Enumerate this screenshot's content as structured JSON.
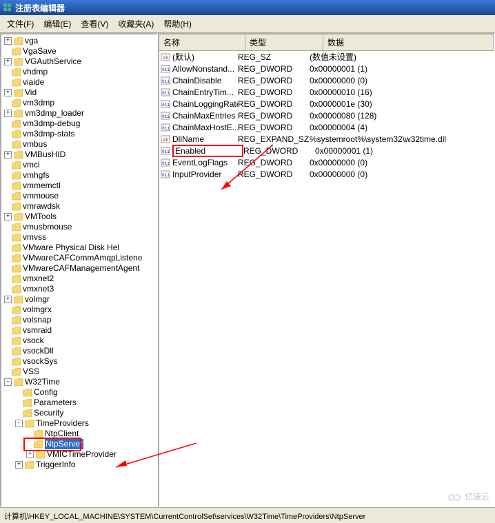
{
  "title": "注册表编辑器",
  "menu": {
    "file": "文件(F)",
    "edit": "编辑(E)",
    "view": "查看(V)",
    "fav": "收藏夹(A)",
    "help": "帮助(H)"
  },
  "columns": {
    "name": "名称",
    "type": "类型",
    "data": "数据"
  },
  "values": [
    {
      "icon": "sz",
      "name": "(默认)",
      "type": "REG_SZ",
      "data": "(数值未设置)"
    },
    {
      "icon": "bin",
      "name": "AllowNonstand...",
      "type": "REG_DWORD",
      "data": "0x00000001 (1)"
    },
    {
      "icon": "bin",
      "name": "ChainDisable",
      "type": "REG_DWORD",
      "data": "0x00000000 (0)"
    },
    {
      "icon": "bin",
      "name": "ChainEntryTim...",
      "type": "REG_DWORD",
      "data": "0x00000010 (16)"
    },
    {
      "icon": "bin",
      "name": "ChainLoggingRate",
      "type": "REG_DWORD",
      "data": "0x0000001e (30)"
    },
    {
      "icon": "bin",
      "name": "ChainMaxEntries",
      "type": "REG_DWORD",
      "data": "0x00000080 (128)"
    },
    {
      "icon": "bin",
      "name": "ChainMaxHostE...",
      "type": "REG_DWORD",
      "data": "0x00000004 (4)"
    },
    {
      "icon": "sz",
      "name": "DllName",
      "type": "REG_EXPAND_SZ",
      "data": "%systemroot%\\system32\\w32time.dll"
    },
    {
      "icon": "bin",
      "name": "Enabled",
      "type": "REG_DWORD",
      "data": "0x00000001 (1)",
      "hl": true
    },
    {
      "icon": "bin",
      "name": "EventLogFlags",
      "type": "REG_DWORD",
      "data": "0x00000000 (0)"
    },
    {
      "icon": "bin",
      "name": "InputProvider",
      "type": "REG_DWORD",
      "data": "0x00000000 (0)"
    }
  ],
  "tree": [
    {
      "e": "+",
      "n": "vga"
    },
    {
      "e": " ",
      "n": "VgaSave"
    },
    {
      "e": "+",
      "n": "VGAuthService"
    },
    {
      "e": " ",
      "n": "vhdmp"
    },
    {
      "e": " ",
      "n": "viaide"
    },
    {
      "e": "+",
      "n": "Vid"
    },
    {
      "e": " ",
      "n": "vm3dmp"
    },
    {
      "e": "+",
      "n": "vm3dmp_loader"
    },
    {
      "e": " ",
      "n": "vm3dmp-debug"
    },
    {
      "e": " ",
      "n": "vm3dmp-stats"
    },
    {
      "e": " ",
      "n": "vmbus"
    },
    {
      "e": "+",
      "n": "VMBusHID"
    },
    {
      "e": " ",
      "n": "vmci"
    },
    {
      "e": " ",
      "n": "vmhgfs"
    },
    {
      "e": " ",
      "n": "vmmemctl"
    },
    {
      "e": " ",
      "n": "vmmouse"
    },
    {
      "e": " ",
      "n": "vmrawdsk"
    },
    {
      "e": "+",
      "n": "VMTools"
    },
    {
      "e": " ",
      "n": "vmusbmouse"
    },
    {
      "e": " ",
      "n": "vmvss"
    },
    {
      "e": " ",
      "n": "VMware Physical Disk Hel"
    },
    {
      "e": " ",
      "n": "VMwareCAFCommAmqpListene"
    },
    {
      "e": " ",
      "n": "VMwareCAFManagementAgent"
    },
    {
      "e": " ",
      "n": "vmxnet2"
    },
    {
      "e": " ",
      "n": "vmxnet3"
    },
    {
      "e": "+",
      "n": "volmgr"
    },
    {
      "e": " ",
      "n": "volmgrx"
    },
    {
      "e": " ",
      "n": "volsnap"
    },
    {
      "e": " ",
      "n": "vsmraid"
    },
    {
      "e": " ",
      "n": "vsock"
    },
    {
      "e": " ",
      "n": "vsockDll"
    },
    {
      "e": " ",
      "n": "vsockSys"
    },
    {
      "e": " ",
      "n": "VSS"
    },
    {
      "e": "-",
      "n": "W32Time",
      "children": [
        {
          "e": " ",
          "n": "Config"
        },
        {
          "e": " ",
          "n": "Parameters"
        },
        {
          "e": " ",
          "n": "Security"
        },
        {
          "e": "-",
          "n": "TimeProviders",
          "children": [
            {
              "e": " ",
              "n": "NtpClient"
            },
            {
              "e": " ",
              "n": "NtpServer",
              "sel": true
            },
            {
              "e": "+",
              "n": "VMICTimeProvider"
            }
          ]
        },
        {
          "e": "+",
          "n": "TriggerInfo"
        }
      ]
    }
  ],
  "statusbar": "计算机\\HKEY_LOCAL_MACHINE\\SYSTEM\\CurrentControlSet\\services\\W32Time\\TimeProviders\\NtpServer",
  "watermark": "亿速云"
}
